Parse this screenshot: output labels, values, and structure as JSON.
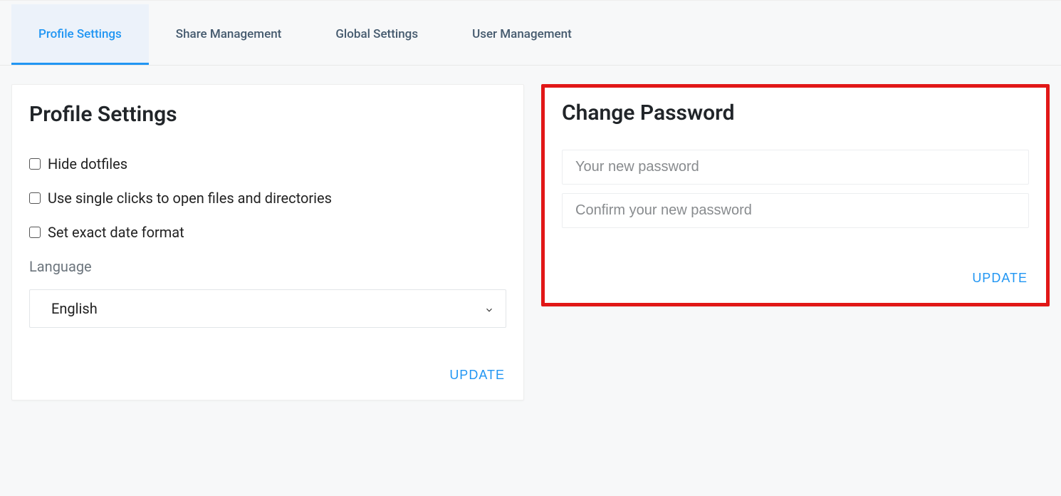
{
  "tabs": {
    "profile": "Profile Settings",
    "share": "Share Management",
    "global": "Global Settings",
    "user": "User Management"
  },
  "profileCard": {
    "title": "Profile Settings",
    "hideDotfiles": "Hide dotfiles",
    "singleClick": "Use single clicks to open files and directories",
    "dateFormat": "Set exact date format",
    "languageLabel": "Language",
    "languageValue": "English",
    "updateLabel": "UPDATE"
  },
  "passwordCard": {
    "title": "Change Password",
    "newPasswordPlaceholder": "Your new password",
    "confirmPasswordPlaceholder": "Confirm your new password",
    "updateLabel": "UPDATE"
  }
}
